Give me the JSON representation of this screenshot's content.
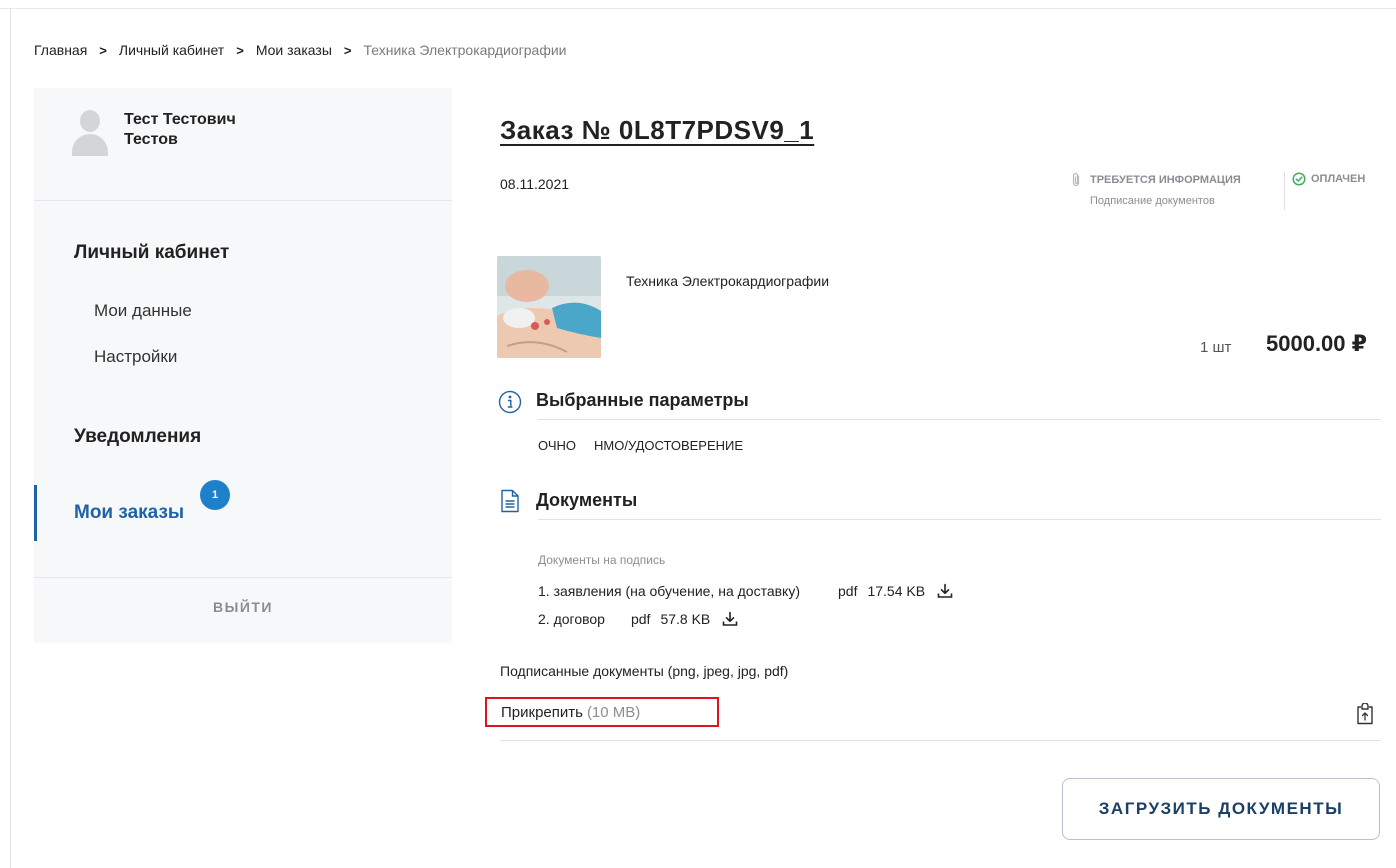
{
  "breadcrumb": [
    "Главная",
    "Личный кабинет",
    "Мои заказы",
    "Техника Электрокардиографии"
  ],
  "sidebar": {
    "user_name_first": "Тест Тестович",
    "user_name_last": "Тестов",
    "section_cabinet": "Личный кабинет",
    "item_my_data": "Мои данные",
    "item_settings": "Настройки",
    "section_notifications": "Уведомления",
    "section_orders": "Мои заказы",
    "orders_badge": "1",
    "logout": "ВЫЙТИ"
  },
  "order": {
    "title": "Заказ № 0L8T7PDSV9_1",
    "date": "08.11.2021",
    "status_info_title": "ТРЕБУЕТСЯ ИНФОРМАЦИЯ",
    "status_info_sub": "Подписание документов",
    "status_paid": "ОПЛАЧЕН",
    "product_name": "Техника Электрокардиографии",
    "qty": "1 шт",
    "price": "5000.00 ₽"
  },
  "params": {
    "title": "Выбранные параметры",
    "values": [
      "ОЧНО",
      "НМО/УДОСТОВЕРЕНИЕ"
    ]
  },
  "documents": {
    "title": "Документы",
    "to_sign_label": "Документы на подпись",
    "items": [
      {
        "name": "1. заявления (на обучение, на доставку)",
        "format": "pdf",
        "size": "17.54 KB"
      },
      {
        "name": "2. договор",
        "format": "pdf",
        "size": "57.8 KB"
      }
    ],
    "signed_label": "Подписанные документы (png, jpeg, jpg, pdf)",
    "attach_label": "Прикрепить",
    "attach_limit": "(10 MB)"
  },
  "upload_button": "ЗАГРУЗИТЬ ДОКУМЕНТЫ",
  "colors": {
    "accent": "#1e63a6",
    "badge": "#1e80c9",
    "paid": "#3fae5a",
    "highlight": "#e0141e"
  }
}
